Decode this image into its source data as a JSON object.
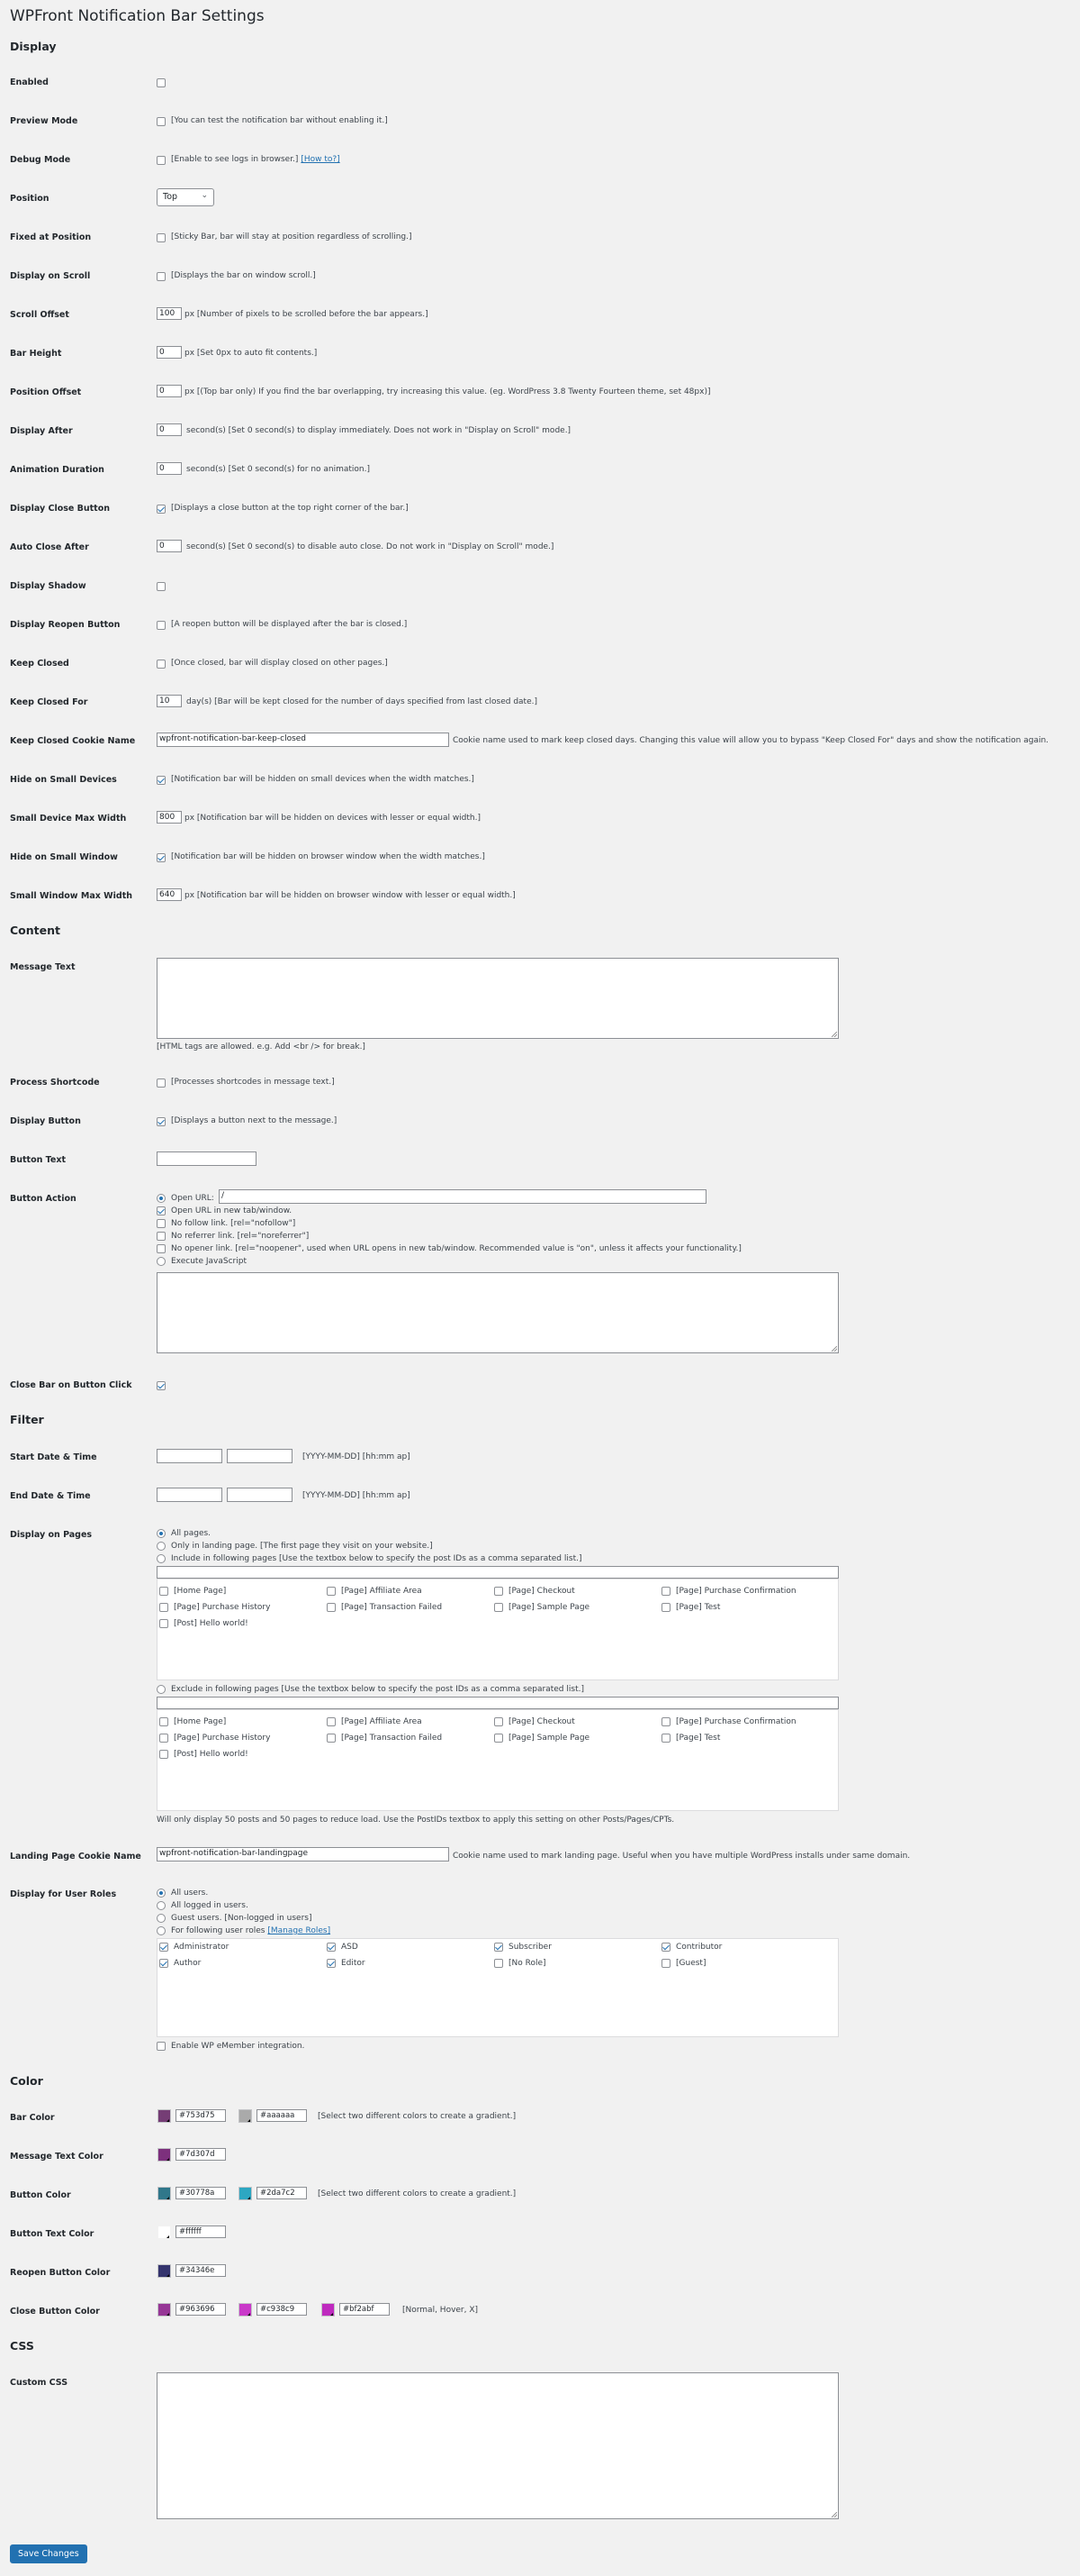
{
  "page": {
    "title": "WPFront Notification Bar Settings"
  },
  "sections": {
    "display": "Display",
    "content": "Content",
    "filter": "Filter",
    "color": "Color",
    "css": "CSS"
  },
  "display": {
    "enabled": {
      "label": "Enabled"
    },
    "preview_mode": {
      "label": "Preview Mode",
      "desc": "[You can test the notification bar without enabling it.]"
    },
    "debug_mode": {
      "label": "Debug Mode",
      "desc": "[Enable to see logs in browser.]",
      "link": "[How to?]"
    },
    "position": {
      "label": "Position",
      "value": "Top"
    },
    "fixed_at_position": {
      "label": "Fixed at Position",
      "desc": "[Sticky Bar, bar will stay at position regardless of scrolling.]"
    },
    "display_on_scroll": {
      "label": "Display on Scroll",
      "desc": "[Displays the bar on window scroll.]"
    },
    "scroll_offset": {
      "label": "Scroll Offset",
      "value": "100",
      "desc": "px [Number of pixels to be scrolled before the bar appears.]"
    },
    "bar_height": {
      "label": "Bar Height",
      "value": "0",
      "desc": "px [Set 0px to auto fit contents.]"
    },
    "position_offset": {
      "label": "Position Offset",
      "value": "0",
      "desc": "px [(Top bar only) If you find the bar overlapping, try increasing this value. (eg. WordPress 3.8 Twenty Fourteen theme, set 48px)]"
    },
    "display_after": {
      "label": "Display After",
      "value": "0",
      "desc": "second(s) [Set 0 second(s) to display immediately. Does not work in \"Display on Scroll\" mode.]"
    },
    "animation_duration": {
      "label": "Animation Duration",
      "value": "0",
      "desc": "second(s) [Set 0 second(s) for no animation.]"
    },
    "display_close_button": {
      "label": "Display Close Button",
      "desc": "[Displays a close button at the top right corner of the bar.]"
    },
    "auto_close_after": {
      "label": "Auto Close After",
      "value": "0",
      "desc": "second(s) [Set 0 second(s) to disable auto close. Do not work in \"Display on Scroll\" mode.]"
    },
    "display_shadow": {
      "label": "Display Shadow"
    },
    "display_reopen_button": {
      "label": "Display Reopen Button",
      "desc": "[A reopen button will be displayed after the bar is closed.]"
    },
    "keep_closed": {
      "label": "Keep Closed",
      "desc": "[Once closed, bar will display closed on other pages.]"
    },
    "keep_closed_for": {
      "label": "Keep Closed For",
      "value": "10",
      "desc": "day(s) [Bar will be kept closed for the number of days specified from last closed date.]"
    },
    "keep_closed_cookie_name": {
      "label": "Keep Closed Cookie Name",
      "value": "wpfront-notification-bar-keep-closed",
      "desc": "Cookie name used to mark keep closed days. Changing this value will allow you to bypass \"Keep Closed For\" days and show the notification again."
    },
    "hide_on_small_devices": {
      "label": "Hide on Small Devices",
      "desc": "[Notification bar will be hidden on small devices when the width matches.]"
    },
    "small_device_max_width": {
      "label": "Small Device Max Width",
      "value": "800",
      "desc": "px [Notification bar will be hidden on devices with lesser or equal width.]"
    },
    "hide_on_small_window": {
      "label": "Hide on Small Window",
      "desc": "[Notification bar will be hidden on browser window when the width matches.]"
    },
    "small_window_max_width": {
      "label": "Small Window Max Width",
      "value": "640",
      "desc": "px [Notification bar will be hidden on browser window with lesser or equal width.]"
    }
  },
  "content": {
    "message_text": {
      "label": "Message Text",
      "hint": "[HTML tags are allowed. e.g. Add <br /> for break.]"
    },
    "process_shortcode": {
      "label": "Process Shortcode",
      "desc": "[Processes shortcodes in message text.]"
    },
    "display_button": {
      "label": "Display Button",
      "desc": "[Displays a button next to the message.]"
    },
    "button_text": {
      "label": "Button Text"
    },
    "button_action": {
      "label": "Button Action",
      "open_url": "Open URL:",
      "url_value": "/",
      "new_tab": "Open URL in new tab/window.",
      "nofollow": "No follow link. [rel=\"nofollow\"]",
      "noreferrer": "No referrer link. [rel=\"noreferrer\"]",
      "noopener": "No opener link. [rel=\"noopener\", used when URL opens in new tab/window. Recommended value is \"on\", unless it affects your functionality.]",
      "execute_js": "Execute JavaScript"
    },
    "close_bar_on_button_click": {
      "label": "Close Bar on Button Click"
    }
  },
  "filter": {
    "start_date": {
      "label": "Start Date & Time",
      "desc": "[YYYY-MM-DD] [hh:mm ap]"
    },
    "end_date": {
      "label": "End Date & Time",
      "desc": "[YYYY-MM-DD] [hh:mm ap]"
    },
    "display_on_pages": {
      "label": "Display on Pages",
      "all_pages": "All pages.",
      "landing_only": "Only in landing page. [The first page they visit on your website.]",
      "include": "Include in following pages [Use the textbox below to specify the post IDs as a comma separated list.]",
      "exclude": "Exclude in following pages [Use the textbox below to specify the post IDs as a comma separated list.]",
      "pages": [
        "[Home Page]",
        "[Page] Affiliate Area",
        "[Page] Checkout",
        "[Page] Purchase Confirmation",
        "[Page] Purchase History",
        "[Page] Transaction Failed",
        "[Page] Sample Page",
        "[Page] Test",
        "[Post] Hello world!"
      ],
      "note": "Will only display 50 posts and 50 pages to reduce load. Use the PostIDs textbox to apply this setting on other Posts/Pages/CPTs."
    },
    "landing_page_cookie_name": {
      "label": "Landing Page Cookie Name",
      "value": "wpfront-notification-bar-landingpage",
      "desc": "Cookie name used to mark landing page. Useful when you have multiple WordPress installs under same domain."
    },
    "display_for_user_roles": {
      "label": "Display for User Roles",
      "all_users": "All users.",
      "logged_in": "All logged in users.",
      "guest": "Guest users. [Non-logged in users]",
      "following": "For following user roles",
      "manage_roles": "[Manage Roles]",
      "roles": [
        "Administrator",
        "ASD",
        "Subscriber",
        "Contributor",
        "Author",
        "Editor",
        "[No Role]",
        "[Guest]"
      ],
      "wp_emember": "Enable WP eMember integration."
    }
  },
  "color": {
    "bar_color": {
      "label": "Bar Color",
      "from": "#753d75",
      "to": "#aaaaaa",
      "desc": "[Select two different colors to create a gradient.]"
    },
    "message_text_color": {
      "label": "Message Text Color",
      "value": "#7d307d"
    },
    "button_color": {
      "label": "Button Color",
      "from": "#30778a",
      "to": "#2da7c2",
      "desc": "[Select two different colors to create a gradient.]"
    },
    "button_text_color": {
      "label": "Button Text Color",
      "value": "#ffffff"
    },
    "reopen_button_color": {
      "label": "Reopen Button Color",
      "value": "#34346e"
    },
    "close_button_color": {
      "label": "Close Button Color",
      "normal": "#963696",
      "hover": "#c938c9",
      "x": "#bf2abf",
      "desc": "[Normal, Hover, X]"
    }
  },
  "css": {
    "custom_css": {
      "label": "Custom CSS"
    }
  },
  "actions": {
    "save": "Save Changes"
  },
  "theme": {
    "accent": "#2271b1",
    "background": "#f1f1f1"
  }
}
